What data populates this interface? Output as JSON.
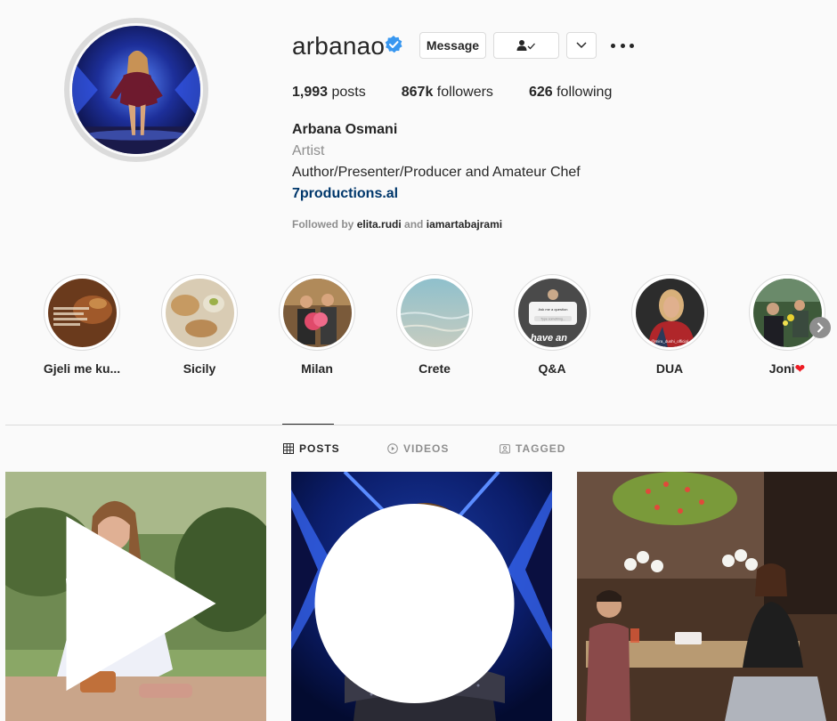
{
  "profile": {
    "username": "arbanao",
    "verified": true,
    "buttons": {
      "message": "Message"
    },
    "stats": [
      {
        "value": "1,993",
        "label": "posts"
      },
      {
        "value": "867k",
        "label": "followers"
      },
      {
        "value": "626",
        "label": "following"
      }
    ],
    "full_name": "Arbana Osmani",
    "category": "Artist",
    "bio": "Author/Presenter/Producer and Amateur Chef",
    "link": "7productions.al",
    "followed_by_prefix": "Followed by",
    "followed_by_1": "elita.rudi",
    "followed_by_and": "and",
    "followed_by_2": "iamartabajrami"
  },
  "highlights": [
    {
      "label": "Gjeli me ku...",
      "icon": "food-highlight"
    },
    {
      "label": "Sicily",
      "icon": "pastry-highlight"
    },
    {
      "label": "Milan",
      "icon": "flowers-highlight"
    },
    {
      "label": "Crete",
      "icon": "sea-highlight"
    },
    {
      "label": "Q&A",
      "icon": "qa-highlight",
      "overlay_text": "have an",
      "card_title": "Ask me a question",
      "card_input": "Type something..."
    },
    {
      "label": "DUA",
      "icon": "portrait-highlight",
      "overlay_text": "@mira_dushi_official"
    },
    {
      "label": "Joni",
      "icon": "garden-highlight",
      "emoji": "❤"
    }
  ],
  "tabs": [
    {
      "label": "POSTS",
      "icon": "grid-icon",
      "active": true
    },
    {
      "label": "VIDEOS",
      "icon": "play-circle-icon",
      "active": false
    },
    {
      "label": "TAGGED",
      "icon": "tag-icon",
      "active": false
    }
  ],
  "posts": [
    {
      "type": "video",
      "icon": "reel-icon",
      "scene": "woman cooking outdoors"
    },
    {
      "type": "carousel",
      "icon": "carousel-icon",
      "scene": "woman in sequin dress on stage"
    },
    {
      "type": "photo",
      "scene": "restaurant with flower ceiling"
    }
  ],
  "colors": {
    "link": "#00376b",
    "verified": "#3897f0",
    "secondary_text": "#8e8e8e",
    "border": "#dbdbdb"
  }
}
